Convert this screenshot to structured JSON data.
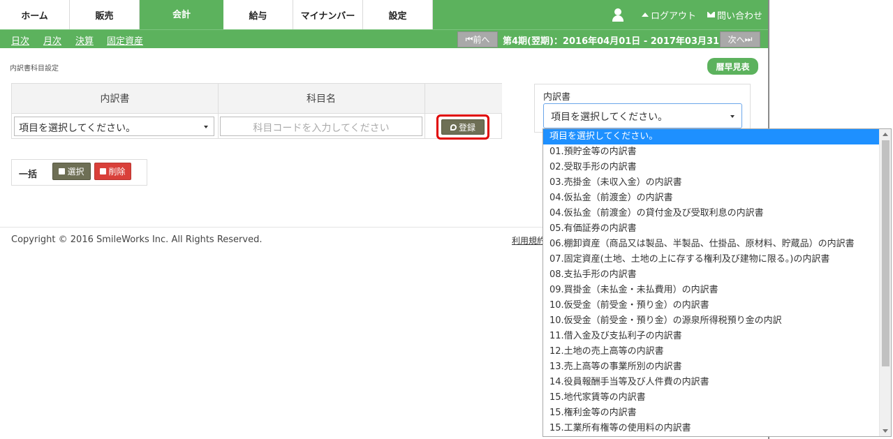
{
  "nav": {
    "tabs": [
      "ホーム",
      "販売",
      "会計",
      "給与",
      "マイナンバー",
      "設定"
    ],
    "active_tab": "会計",
    "logout_label": "ログアウト",
    "contact_label": "問い合わせ"
  },
  "subnav": {
    "links": [
      "日次",
      "月次",
      "決算",
      "固定資産"
    ],
    "prev_label": "前へ",
    "next_label": "次へ",
    "period_text": "第4期(翌期)：2016年04月01日 - 2017年03月31日"
  },
  "page": {
    "breadcrumb": "内訳書科目設定",
    "list_button": "暦早見表"
  },
  "table": {
    "headers": [
      "内訳書",
      "科目名",
      ""
    ],
    "row": {
      "select_value": "項目を選択してください。",
      "input_placeholder": "科目コードを入力してください",
      "register_label": "登録"
    }
  },
  "batch": {
    "label": "一括",
    "select_label": "選択",
    "delete_label": "削除"
  },
  "footer": {
    "copyright": "Copyright © 2016 SmileWorks Inc. All Rights Reserved.",
    "terms": "利用規約"
  },
  "panel": {
    "label": "内訳書",
    "select_value": "項目を選択してください。",
    "options": [
      "項目を選択してください。",
      "01.預貯金等の内訳書",
      "02.受取手形の内訳書",
      "03.売掛金（未収入金）の内訳書",
      "04.仮払金（前渡金）の内訳書",
      "04.仮払金（前渡金）の貸付金及び受取利息の内訳書",
      "05.有価証券の内訳書",
      "06.棚卸資産（商品又は製品、半製品、仕掛品、原材料、貯蔵品）の内訳書",
      "07.固定資産(土地、土地の上に存する権利及び建物に限る。)の内訳書",
      "08.支払手形の内訳書",
      "09.買掛金（未払金・未払費用）の内訳書",
      "10.仮受金（前受金・預り金）の内訳書",
      "10.仮受金（前受金・預り金）の源泉所得税預り金の内訳",
      "11.借入金及び支払利子の内訳書",
      "12.土地の売上高等の内訳書",
      "13.売上高等の事業所別の内訳書",
      "14.役員報酬手当等及び人件費の内訳書",
      "15.地代家賃等の内訳書",
      "15.権利金等の内訳書",
      "15.工業所有権等の使用料の内訳書"
    ],
    "selected_index": 0
  },
  "colors": {
    "brand_green": "#5cb25d",
    "highlight_red": "#e00000",
    "option_selected": "#1e90ff"
  }
}
